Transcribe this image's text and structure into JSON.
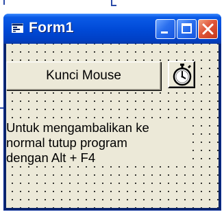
{
  "window": {
    "title": "Form1"
  },
  "form": {
    "lock_button_label": "Kunci Mouse",
    "info_text": "Untuk mengambalikan ke\nnormal tutup program\ndengan Alt + F4"
  },
  "colors": {
    "titlebar": "#0049d6",
    "client": "#ece9d8",
    "close_button": "#e0563a"
  },
  "icons": {
    "app": "form-icon",
    "timer": "stopwatch-icon",
    "minimize": "minimize-icon",
    "maximize": "maximize-icon",
    "close": "close-icon"
  }
}
